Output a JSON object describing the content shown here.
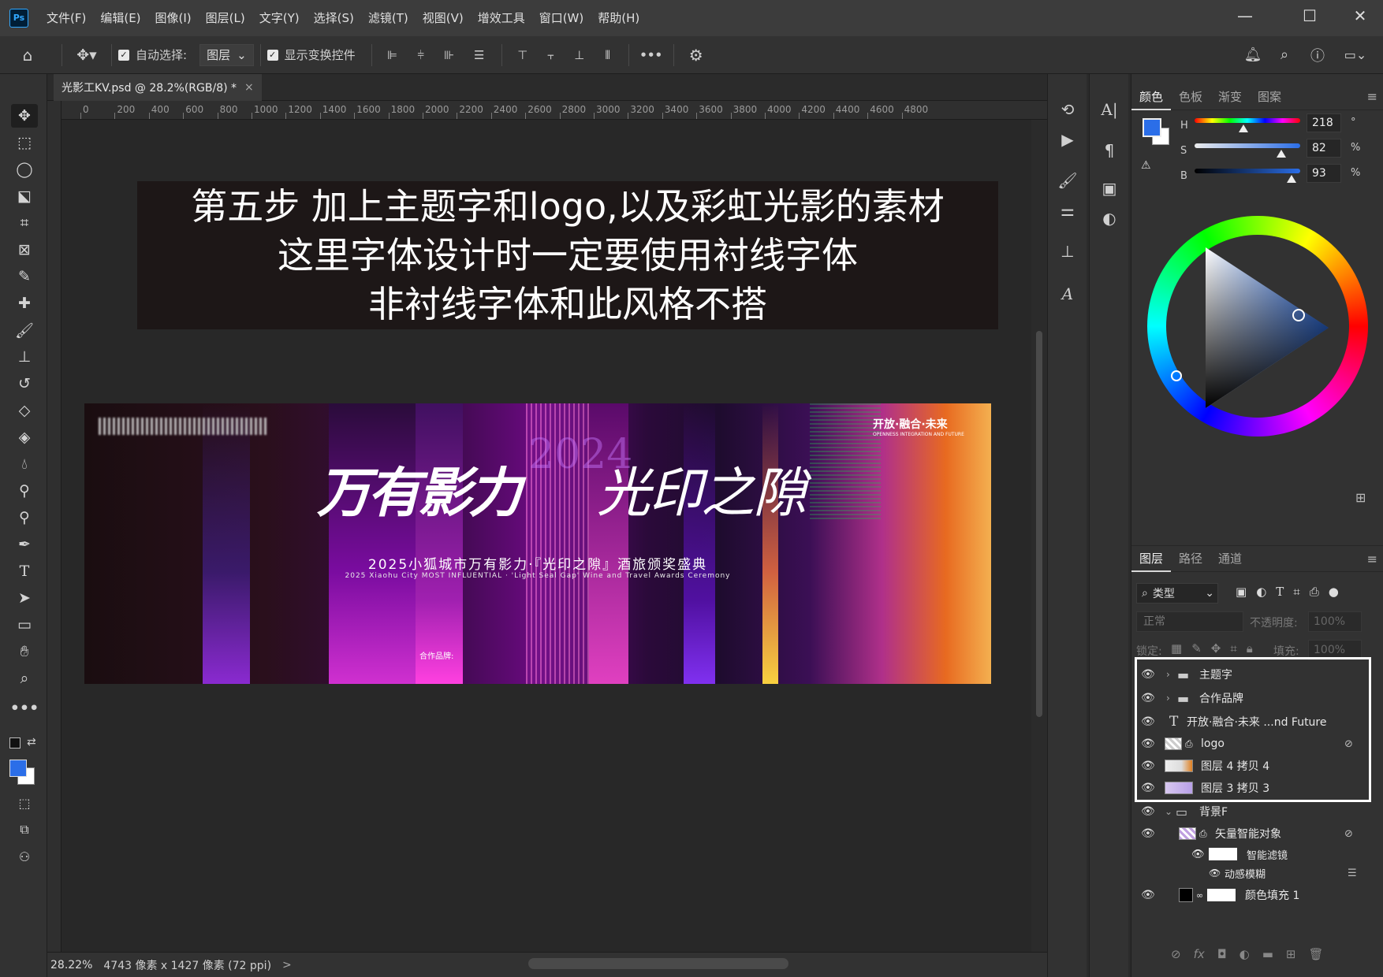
{
  "app": {
    "logo": "Ps"
  },
  "menu": [
    "文件(F)",
    "编辑(E)",
    "图像(I)",
    "图层(L)",
    "文字(Y)",
    "选择(S)",
    "滤镜(T)",
    "视图(V)",
    "增效工具",
    "窗口(W)",
    "帮助(H)"
  ],
  "window_controls": {
    "minimize": "—",
    "maximize": "☐",
    "close": "✕"
  },
  "optionsbar": {
    "auto_select_label": "自动选择:",
    "auto_select_target": "图层",
    "show_transform_label": "显示变换控件",
    "more": "•••"
  },
  "document": {
    "tab_title": "光影工KV.psd @ 28.2%(RGB/8) *",
    "close": "×"
  },
  "ruler": {
    "ticks": [
      "0",
      "200",
      "400",
      "600",
      "800",
      "1000",
      "1200",
      "1400",
      "1600",
      "1800",
      "2000",
      "2200",
      "2400",
      "2600",
      "2800",
      "3000",
      "3200",
      "3400",
      "3600",
      "3800",
      "4000",
      "4200",
      "4400",
      "4600",
      "4800"
    ]
  },
  "caption": {
    "line1": "第五步 加上主题字和logo,以及彩虹光影的素材",
    "line2": "这里字体设计时一定要使用衬线字体",
    "line3": "非衬线字体和此风格不搭"
  },
  "banner": {
    "title_left": "万有影力",
    "year": "2024",
    "title_right": "光印之隙",
    "subtitle": "2025小狐城市万有影力·『光印之隙』酒旅颁奖盛典",
    "subtitle_en": "2025 Xiaohu City MOST INFLUENTIAL · 'Light Seal Gap' Wine and Travel Awards Ceremony",
    "top_right": "开放·融合·未来",
    "top_right_en": "OPENNESS INTEGRATION AND FUTURE",
    "partner": "合作品牌:"
  },
  "status": {
    "zoom": "28.22%",
    "info": "4743 像素 x 1427 像素 (72 ppi)",
    "arrow": ">"
  },
  "color_panel": {
    "tabs": [
      "颜色",
      "色板",
      "渐变",
      "图案"
    ],
    "active_tab": "颜色",
    "h": {
      "label": "H",
      "value": "218",
      "unit": "°"
    },
    "s": {
      "label": "S",
      "value": "82",
      "unit": "%"
    },
    "b": {
      "label": "B",
      "value": "93",
      "unit": "%"
    },
    "foreground": "#2b6ee8",
    "background": "#ffffff"
  },
  "layers_panel": {
    "tabs": [
      "图层",
      "路径",
      "通道"
    ],
    "active_tab": "图层",
    "filter_kind": "类型",
    "blend_mode": "正常",
    "opacity_label": "不透明度:",
    "opacity": "100%",
    "lock_label": "锁定:",
    "fill_label": "填充:",
    "fill": "100%",
    "layers": [
      {
        "name": "主题字",
        "type": "group"
      },
      {
        "name": "合作品牌",
        "type": "group"
      },
      {
        "name": "开放·融合·未来 ...nd Future",
        "type": "text"
      },
      {
        "name": "logo",
        "type": "smart"
      },
      {
        "name": "图层 4 拷贝 4",
        "type": "pixel"
      },
      {
        "name": "图层 3 拷贝 3",
        "type": "pixel"
      },
      {
        "name": "背景F",
        "type": "group-open"
      },
      {
        "name": "矢量智能对象",
        "type": "smart"
      },
      {
        "name": "智能滤镜",
        "type": "filter"
      },
      {
        "name": "动感模糊",
        "type": "filter-item"
      },
      {
        "name": "颜色填充 1",
        "type": "fill"
      }
    ]
  }
}
